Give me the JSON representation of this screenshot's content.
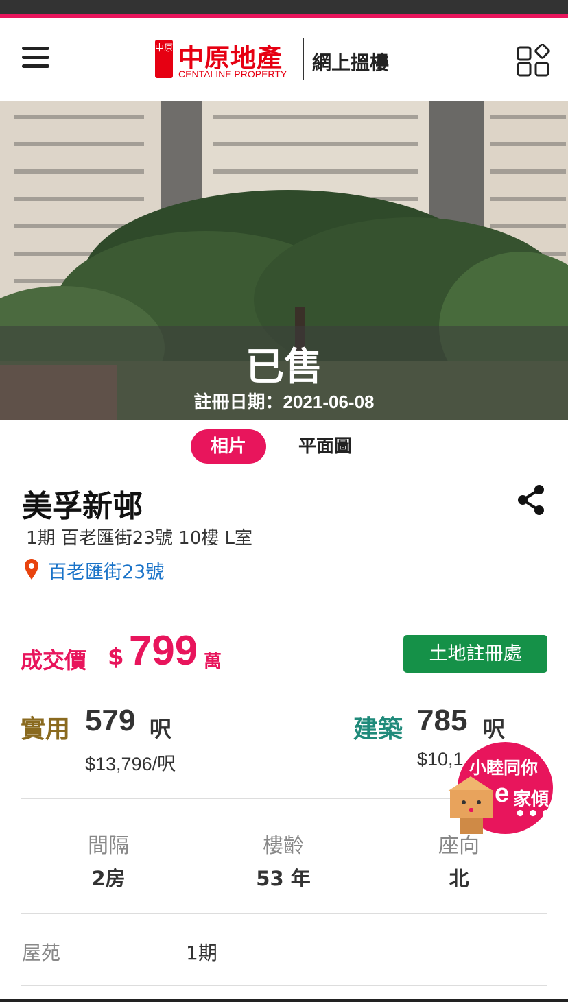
{
  "header": {
    "logo_seal": "中原",
    "logo_title": "中原地產",
    "logo_subtitle": "CENTALINE PROPERTY",
    "slogan": "網上搵樓",
    "menu_icon": "hamburger-menu-icon",
    "apps_icon": "apps-grid-icon"
  },
  "hero": {
    "status": "已售",
    "register_date": "註冊日期：2021-06-08"
  },
  "tabs": [
    {
      "label": "相片",
      "active": true
    },
    {
      "label": "平面圖",
      "active": false
    }
  ],
  "property": {
    "title": "美孚新邨",
    "address": "1期 百老匯街23號 10樓 L室",
    "map_link": "百老匯街23號"
  },
  "price": {
    "label": "成交價",
    "currency": "$",
    "value": "799",
    "unit": "萬",
    "land_registry_button": "土地註冊處"
  },
  "area": {
    "saleable": {
      "label": "實用",
      "value": "579",
      "unit": "呎",
      "price_per_sqft": "$13,796/呎"
    },
    "gross": {
      "label": "建築",
      "value": "785",
      "unit": "呎",
      "price_per_sqft": "$10,1"
    }
  },
  "stats": [
    {
      "label": "間隔",
      "value": "2房"
    },
    {
      "label": "樓齡",
      "value": "53 年"
    },
    {
      "label": "座向",
      "value": "北"
    }
  ],
  "details": [
    {
      "label": "屋苑",
      "value": "1期"
    }
  ],
  "chat": {
    "line1": "小睦同你",
    "e": "e",
    "line2": "家傾",
    "dots": "•••"
  },
  "colors": {
    "accent": "#e8155c",
    "brand_red": "#e60012",
    "link_blue": "#1a73c8",
    "registry_green": "#159148",
    "saleable_gold": "#8a6a1f",
    "gross_teal": "#1f8a7a"
  }
}
